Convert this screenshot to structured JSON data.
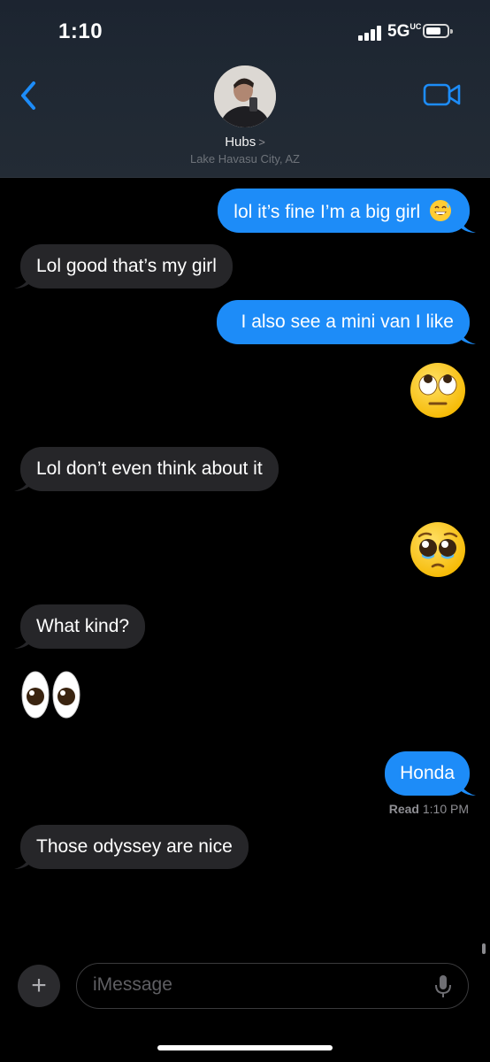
{
  "status_bar": {
    "time": "1:10",
    "network": "5G",
    "network_suffix": "UC"
  },
  "header": {
    "contact_name": "Hubs",
    "contact_location": "Lake Havasu City, AZ",
    "back_icon": "chevron-left-icon",
    "video_icon": "video-camera-icon"
  },
  "messages": [
    {
      "direction": "out",
      "type": "text",
      "text": "lol it’s fine I’m a big girl",
      "emoji": "grinning-sweat"
    },
    {
      "direction": "in",
      "type": "text",
      "text": "Lol good that’s my girl"
    },
    {
      "direction": "out",
      "type": "text",
      "text": "I also see a mini van I like"
    },
    {
      "direction": "out",
      "type": "emoji",
      "emoji": "face-with-rolling-eyes"
    },
    {
      "direction": "in",
      "type": "text",
      "text": "Lol don’t even think about it"
    },
    {
      "direction": "out",
      "type": "emoji",
      "emoji": "pleading-face"
    },
    {
      "direction": "in",
      "type": "text",
      "text": "What kind?"
    },
    {
      "direction": "in",
      "type": "emoji",
      "emoji": "eyes"
    },
    {
      "direction": "out",
      "type": "text",
      "text": "Honda"
    },
    {
      "direction": "in",
      "type": "text",
      "text": "Those odyssey are nice"
    }
  ],
  "read_receipt": {
    "label": "Read",
    "time": "1:10 PM"
  },
  "input_bar": {
    "placeholder": "iMessage",
    "plus_label": "+",
    "mic_icon": "microphone-icon"
  },
  "colors": {
    "outgoing_bubble": "#1d8cf8",
    "incoming_bubble": "#262629",
    "background": "#000000",
    "accent": "#1d8cf8"
  }
}
